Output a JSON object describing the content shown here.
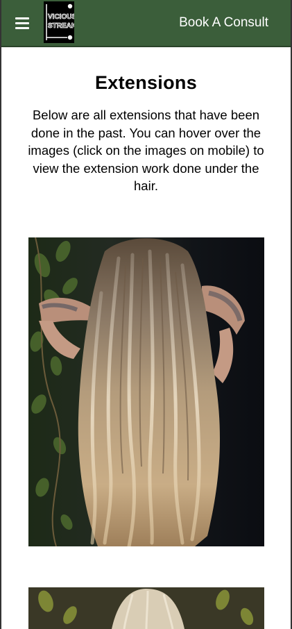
{
  "header": {
    "menu_icon": "hamburger-menu-icon",
    "logo_text_line1": "VICIOUS",
    "logo_text_line2": "STREAK",
    "cta_label": "Book A Consult",
    "background_color": "#3b5e3a"
  },
  "main": {
    "title": "Extensions",
    "intro": "Below are all extensions that have been done in the past. You can hover over the images (click on the images on mobile) to view the extension work done under the hair."
  }
}
